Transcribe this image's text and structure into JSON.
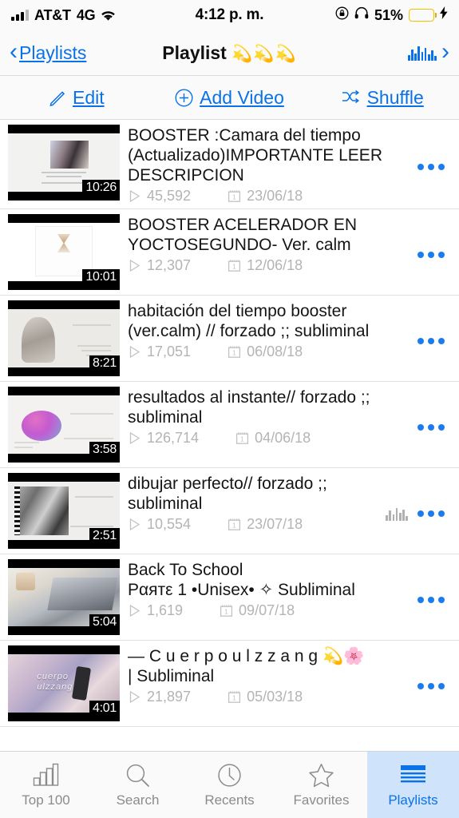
{
  "status_bar": {
    "carrier": "AT&T",
    "network": "4G",
    "time": "4:12 p. m.",
    "battery_percent": "51%",
    "battery_level": 51,
    "icons": [
      "signal-bars-icon",
      "wifi-icon",
      "rotation-lock-icon",
      "headphones-icon",
      "battery-icon",
      "charging-bolt-icon"
    ],
    "battery_color": "#f5c518"
  },
  "nav_bar": {
    "back_label": "Playlists",
    "title": "Playlist",
    "title_emoji": "💫💫💫",
    "now_playing_icon": "equalizer-icon",
    "forward_icon": "chevron-right-icon",
    "accent_color": "#0a72e8"
  },
  "toolbar": {
    "edit_label": "Edit",
    "add_video_label": "Add Video",
    "shuffle_label": "Shuffle"
  },
  "list": {
    "rows": [
      {
        "title": "BOOSTER :Camara del tiempo (Actualizado)IMPORTANTE LEER DESCRIPCION",
        "views": "45,592",
        "date": "23/06/18",
        "duration": "10:26",
        "now_playing": false
      },
      {
        "title": "BOOSTER ACELERADOR EN YOCTOSEGUNDO- Ver. calm",
        "views": "12,307",
        "date": "12/06/18",
        "duration": "10:01",
        "now_playing": false
      },
      {
        "title": "habitación del tiempo booster (ver.calm) // forzado ;; subliminal",
        "views": "17,051",
        "date": "06/08/18",
        "duration": "8:21",
        "now_playing": false
      },
      {
        "title": "resultados al instante// forzado ;; subliminal",
        "views": "126,714",
        "date": "04/06/18",
        "duration": "3:58",
        "now_playing": false
      },
      {
        "title": "dibujar perfecto// forzado ;; subliminal",
        "views": "10,554",
        "date": "23/07/18",
        "duration": "2:51",
        "now_playing": true
      },
      {
        "title": "Back To School Ραятε 1 •Unisex• ✧ Subliminal",
        "title_line1": "Back To School",
        "title_line2": "Ραятε 1 •Unisex• ✧ Subliminal",
        "views": "1,619",
        "date": "09/07/18",
        "duration": "5:04",
        "now_playing": false
      },
      {
        "title": "— C u e r p o  u l z z a n g 💫🌸 | Subliminal",
        "title_line1": "— C u e r p o  u l z z a n g",
        "title_emoji": "💫🌸",
        "title_line2": "| Subliminal",
        "views": "21,897",
        "date": "05/03/18",
        "duration": "4:01",
        "now_playing": false,
        "thumb_overlay_1": "cuerpo",
        "thumb_overlay_2": "ulzzang"
      }
    ],
    "menu_icon": "more-options-icon",
    "views_icon": "play-triangle-icon",
    "date_icon": "calendar-icon"
  },
  "tab_bar": {
    "tabs": [
      {
        "label": "Top 100",
        "icon": "bar-chart-icon",
        "active": false
      },
      {
        "label": "Search",
        "icon": "search-icon",
        "active": false
      },
      {
        "label": "Recents",
        "icon": "clock-icon",
        "active": false
      },
      {
        "label": "Favorites",
        "icon": "star-icon",
        "active": false
      },
      {
        "label": "Playlists",
        "icon": "list-icon",
        "active": true
      }
    ],
    "active_bg": "#cfe4fb",
    "active_color": "#0a72e8"
  }
}
